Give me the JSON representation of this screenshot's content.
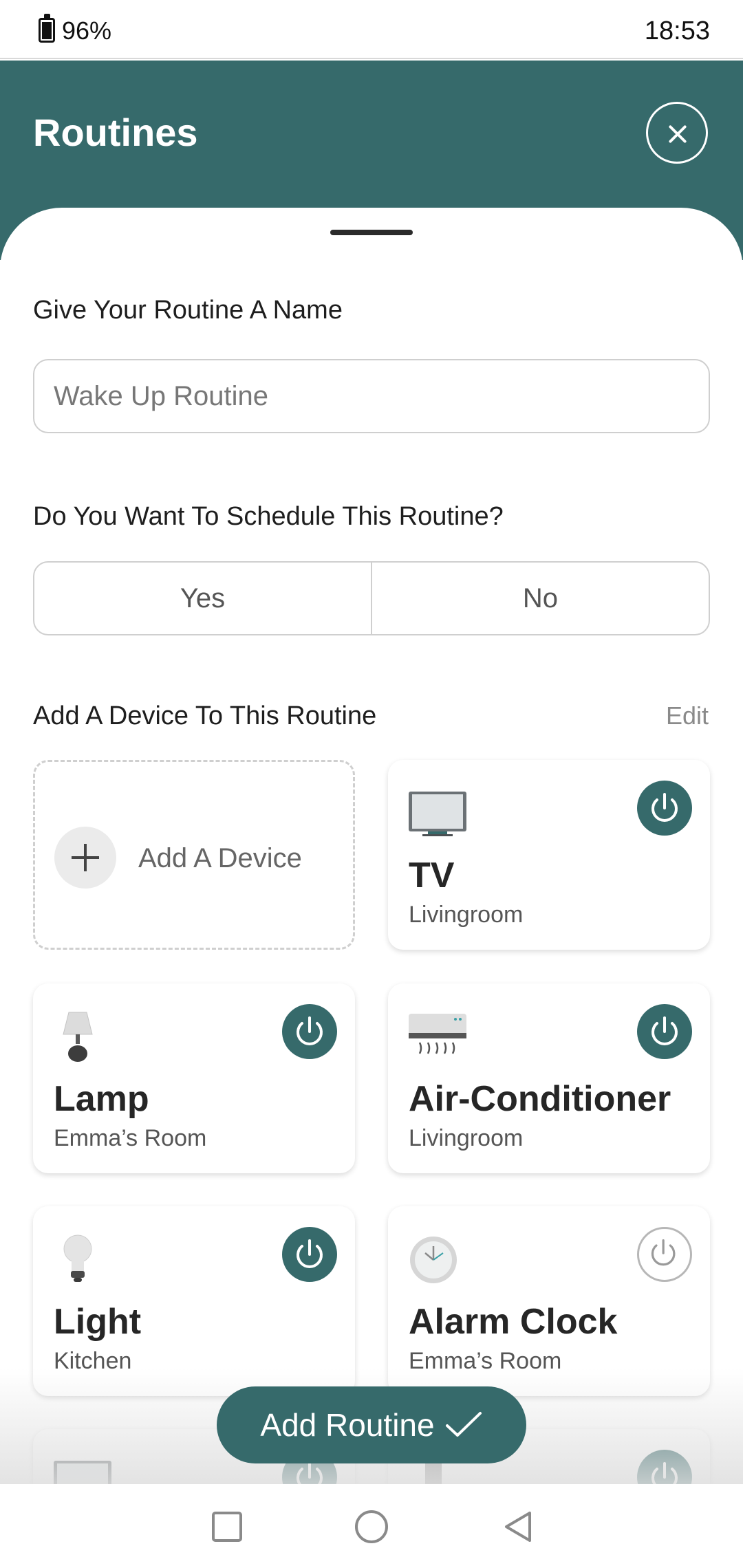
{
  "status_bar": {
    "battery": "96%",
    "time": "18:53"
  },
  "header": {
    "title": "Routines"
  },
  "form": {
    "name_label": "Give Your Routine A Name",
    "name_placeholder": "Wake Up Routine",
    "schedule_label": "Do You Want To Schedule This Routine?",
    "schedule_options": [
      "Yes",
      "No"
    ],
    "devices_label": "Add A Device To This Routine",
    "edit_label": "Edit"
  },
  "add_device_label": "Add A Device",
  "devices": [
    {
      "name": "TV",
      "room": "Livingroom",
      "icon": "tv-icon",
      "power": "on"
    },
    {
      "name": "Lamp",
      "room": "Emma’s Room",
      "icon": "lamp-icon",
      "power": "on"
    },
    {
      "name": "Air-Conditioner",
      "room": "Livingroom",
      "icon": "air-conditioner-icon",
      "power": "on"
    },
    {
      "name": "Light",
      "room": "Kitchen",
      "icon": "light-bulb-icon",
      "power": "on"
    },
    {
      "name": "Alarm Clock",
      "room": "Emma’s Room",
      "icon": "clock-icon",
      "power": "off"
    }
  ],
  "primary_action": {
    "label": "Add Routine"
  },
  "colors": {
    "accent": "#366a6b"
  }
}
